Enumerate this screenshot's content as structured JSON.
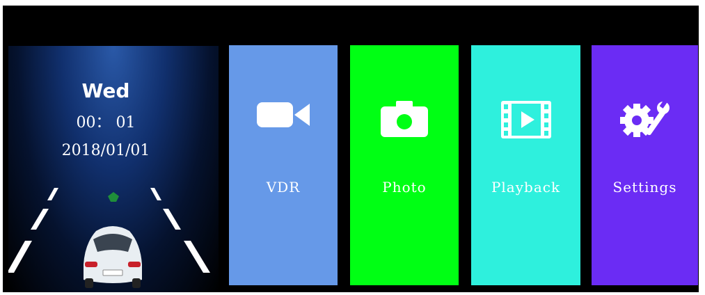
{
  "status": {
    "day": "Wed",
    "time": "00： 01",
    "date": "2018/01/01",
    "car_graphic": "car-on-road-icon"
  },
  "menu": {
    "items": [
      {
        "label": "VDR",
        "icon": "video-camera-icon",
        "color": "#6699e8"
      },
      {
        "label": "Photo",
        "icon": "camera-icon",
        "color": "#00ff14"
      },
      {
        "label": "Playback",
        "icon": "film-play-icon",
        "color": "#2ef0dd"
      },
      {
        "label": "Settings",
        "icon": "gear-wrench-icon",
        "color": "#6b2cf4"
      }
    ]
  }
}
